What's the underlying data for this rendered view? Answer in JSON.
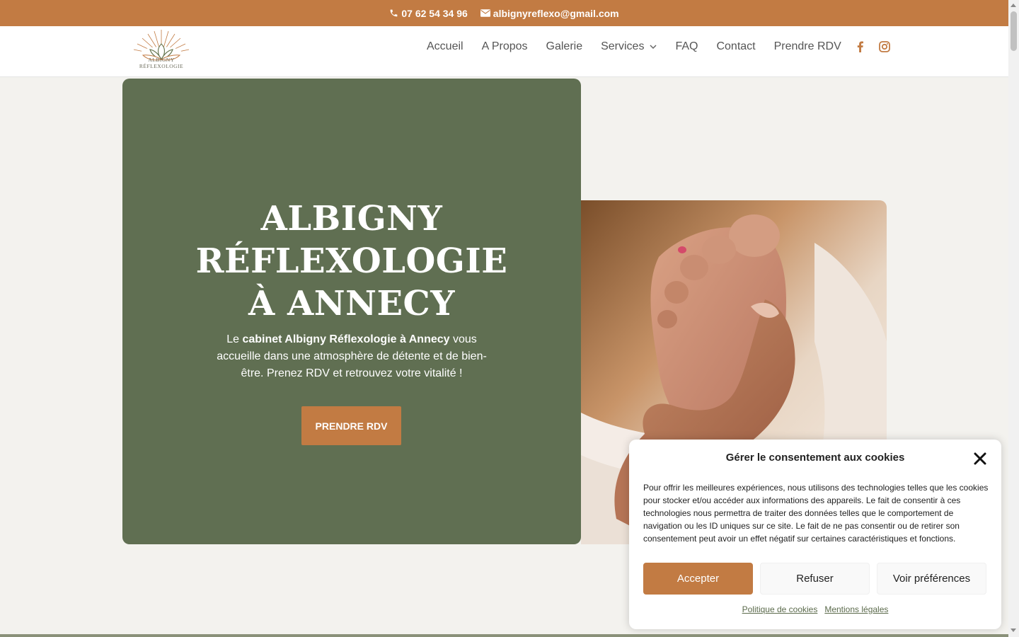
{
  "topbar": {
    "phone": "07 62 54 34 96",
    "email": "albignyreflexo@gmail.com",
    "phone_icon": "phone-icon",
    "email_icon": "envelope-icon",
    "color": "#c27b43"
  },
  "header": {
    "logo_text": "ALBIGNY RÉFLEXOLOGIE",
    "nav": [
      {
        "label": "Accueil"
      },
      {
        "label": "A Propos"
      },
      {
        "label": "Galerie"
      },
      {
        "label": "Services"
      },
      {
        "label": "FAQ"
      },
      {
        "label": "Contact"
      },
      {
        "label": "Prendre RDV"
      }
    ],
    "social": [
      "facebook-icon",
      "instagram-icon"
    ]
  },
  "hero": {
    "title_line1": "ALBIGNY",
    "title_line2": "RÉFLEXOLOGIE",
    "title_line3": "À ANNECY",
    "text_prefix": "Le ",
    "text_bold": "cabinet Albigny Réflexologie à Annecy",
    "text_suffix": " vous accueille dans une atmosphère de détente et de bien-être. Prenez RDV et retrouvez votre vitalité !",
    "button": "PRENDRE RDV",
    "panel_color": "#606f52"
  },
  "cookie": {
    "title": "Gérer le consentement aux cookies",
    "body": "Pour offrir les meilleures expériences, nous utilisons des technologies telles que les cookies pour stocker et/ou accéder aux informations des appareils. Le fait de consentir à ces technologies nous permettra de traiter des données telles que le comportement de navigation ou les ID uniques sur ce site. Le fait de ne pas consentir ou de retirer son consentement peut avoir un effet négatif sur certaines caractéristiques et fonctions.",
    "accept": "Accepter",
    "refuse": "Refuser",
    "preferences": "Voir préférences",
    "link_cookies": "Politique de cookies",
    "link_legal": "Mentions légales"
  }
}
